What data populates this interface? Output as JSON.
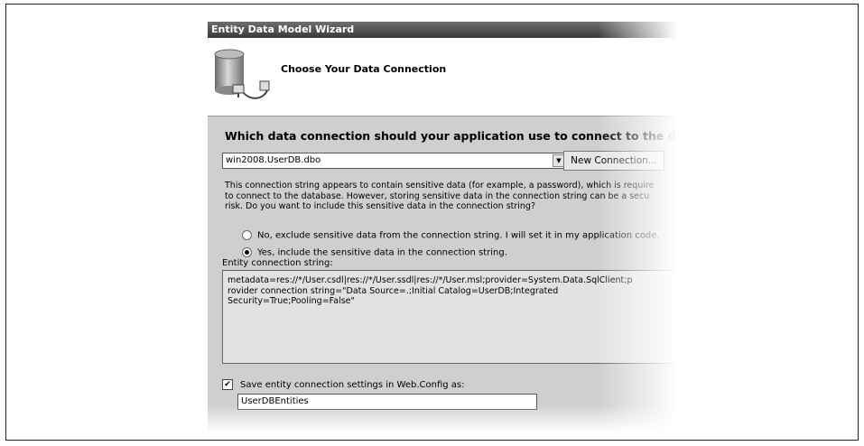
{
  "window": {
    "title": "Entity Data Model Wizard"
  },
  "header": {
    "title": "Choose Your Data Connection",
    "icon": "database-connection-icon"
  },
  "question": "Which data connection should your application use to connect to the database?",
  "connection_select": {
    "value": "win2008.UserDB.dbo"
  },
  "new_connection_button": "New Connection...",
  "sensitive_note": {
    "line1": "This connection string appears to contain sensitive data (for example, a password), which is require",
    "line2": "to connect to the database.  However, storing sensitive data in the connection string can be a secu",
    "line3": "risk. Do you want to include this sensitive data in the connection string?"
  },
  "options": {
    "exclude": "No, exclude sensitive data from the connection string. I will set it in my application code.",
    "include": "Yes, include the sensitive data in the connection string.",
    "selected": "include"
  },
  "entity_connection": {
    "label": "Entity connection string:",
    "line1": "metadata=res://*/User.csdl|res://*/User.ssdl|res://*/User.msl;provider=System.Data.SqlClient;p",
    "line2": "rovider connection string=\"Data Source=.;Initial Catalog=UserDB;Integrated",
    "line3": "Security=True;Pooling=False\""
  },
  "save_settings": {
    "label": "Save entity connection settings in Web.Config as:",
    "checked": true,
    "value": "UserDBEntities"
  }
}
